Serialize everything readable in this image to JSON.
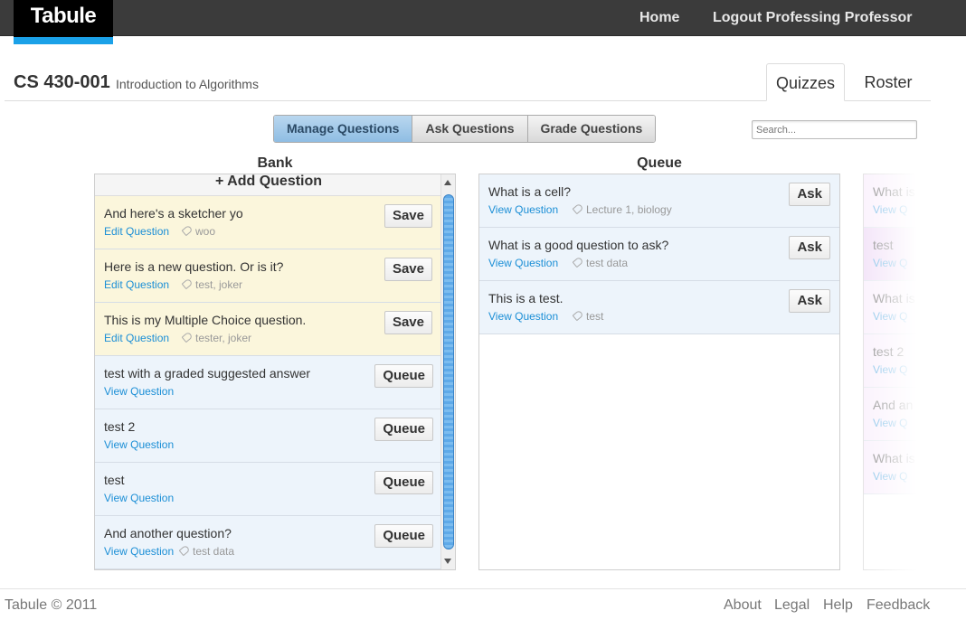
{
  "app": {
    "logo": "Tabule"
  },
  "nav": {
    "home": "Home",
    "logout": "Logout Professing Professor"
  },
  "course": {
    "code": "CS 430-001",
    "name": "Introduction to Algorithms"
  },
  "tabs": [
    {
      "label": "Quizzes",
      "active": true
    },
    {
      "label": "Roster",
      "active": false
    }
  ],
  "modes": [
    {
      "label": "Manage Questions",
      "active": true
    },
    {
      "label": "Ask Questions",
      "active": false
    },
    {
      "label": "Grade Questions",
      "active": false
    }
  ],
  "search": {
    "placeholder": "Search..."
  },
  "bank": {
    "title": "Bank",
    "add_label": "+ Add Question",
    "items": [
      {
        "question": "And here's a sketcher yo",
        "link": "Edit Question",
        "tags": "woo",
        "action": "Save",
        "state": "edit"
      },
      {
        "question": "Here is a new question. Or is it?",
        "link": "Edit Question",
        "tags": "test, joker",
        "action": "Save",
        "state": "edit"
      },
      {
        "question": "This is my Multiple Choice question.",
        "link": "Edit Question",
        "tags": "tester, joker",
        "action": "Save",
        "state": "edit"
      },
      {
        "question": "test with a graded suggested answer",
        "link": "View Question",
        "tags": "",
        "action": "Queue",
        "state": "view"
      },
      {
        "question": "test 2",
        "link": "View Question",
        "tags": "",
        "action": "Queue",
        "state": "view"
      },
      {
        "question": "test",
        "link": "View Question",
        "tags": "",
        "action": "Queue",
        "state": "view"
      },
      {
        "question": "And another question?",
        "link": "View Question",
        "tags": "test data",
        "action": "Queue",
        "state": "view"
      }
    ]
  },
  "queue": {
    "title": "Queue",
    "items": [
      {
        "question": "What is a cell?",
        "link": "View Question",
        "tags": "Lecture 1, biology",
        "action": "Ask"
      },
      {
        "question": "What is a good question to ask?",
        "link": "View Question",
        "tags": "test data",
        "action": "Ask"
      },
      {
        "question": "This is a test.",
        "link": "View Question",
        "tags": "test",
        "action": "Ask"
      }
    ]
  },
  "third_column": {
    "items": [
      {
        "question": "What is",
        "link": "View Q",
        "state": "pink"
      },
      {
        "question": "test",
        "link": "View Q",
        "state": "purple"
      },
      {
        "question": "What is",
        "link": "View Q",
        "state": "pink"
      },
      {
        "question": "test 2",
        "link": "View Q",
        "state": "pink"
      },
      {
        "question": "And an",
        "link": "View Q",
        "state": "pink"
      },
      {
        "question": "What is",
        "link": "View Q",
        "state": "pink"
      }
    ]
  },
  "footer": {
    "copyright": "Tabule © 2011",
    "links": [
      "About",
      "Legal",
      "Help",
      "Feedback"
    ]
  },
  "colors": {
    "accent": "#1ba1e8",
    "link": "#1c8fd6",
    "topbar": "#3b3b3b",
    "edit_bg": "#fbf6dc",
    "view_bg": "#edf4fb"
  }
}
